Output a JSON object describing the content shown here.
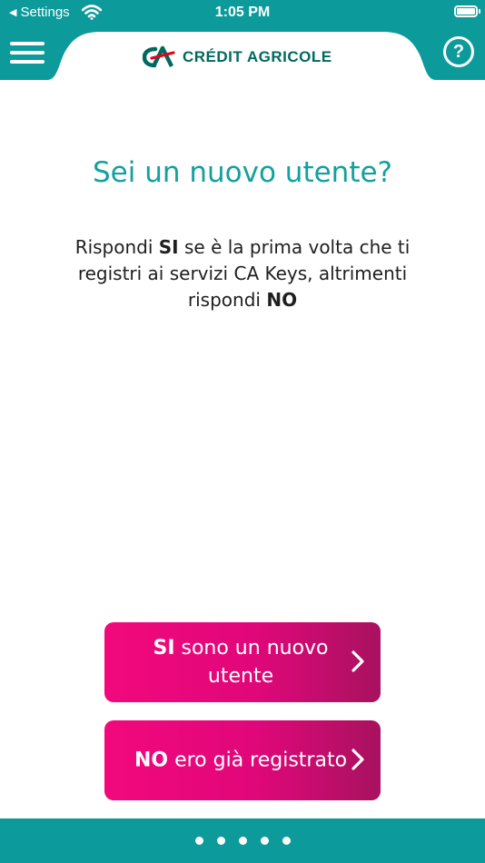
{
  "status_bar": {
    "back_label": "Settings",
    "time": "1:05 PM"
  },
  "header": {
    "brand_name": "CRÉDIT AGRICOLE",
    "help_label": "?"
  },
  "content": {
    "title": "Sei un nuovo utente?",
    "description": {
      "part1": "Rispondi ",
      "bold1": "SI",
      "part2": " se è la prima volta che ti registri ai servizi CA Keys, altrimenti rispondi ",
      "bold2": "NO"
    }
  },
  "buttons": {
    "yes": {
      "bold": "SI",
      "text": " sono un nuovo utente"
    },
    "no": {
      "bold": "NO",
      "text": " ero già registrato"
    }
  },
  "pagination": {
    "total": 5
  },
  "colors": {
    "teal": "#0c9a9a",
    "title_teal": "#14a0a0",
    "brand_green": "#00695e",
    "brand_red": "#e2001a",
    "button_pink": "#f2087d",
    "button_purple": "#a8125f"
  },
  "icons": [
    "back-arrow-icon",
    "wifi-icon",
    "battery-icon",
    "menu-icon",
    "help-icon",
    "logo-icon",
    "chevron-right-icon"
  ]
}
